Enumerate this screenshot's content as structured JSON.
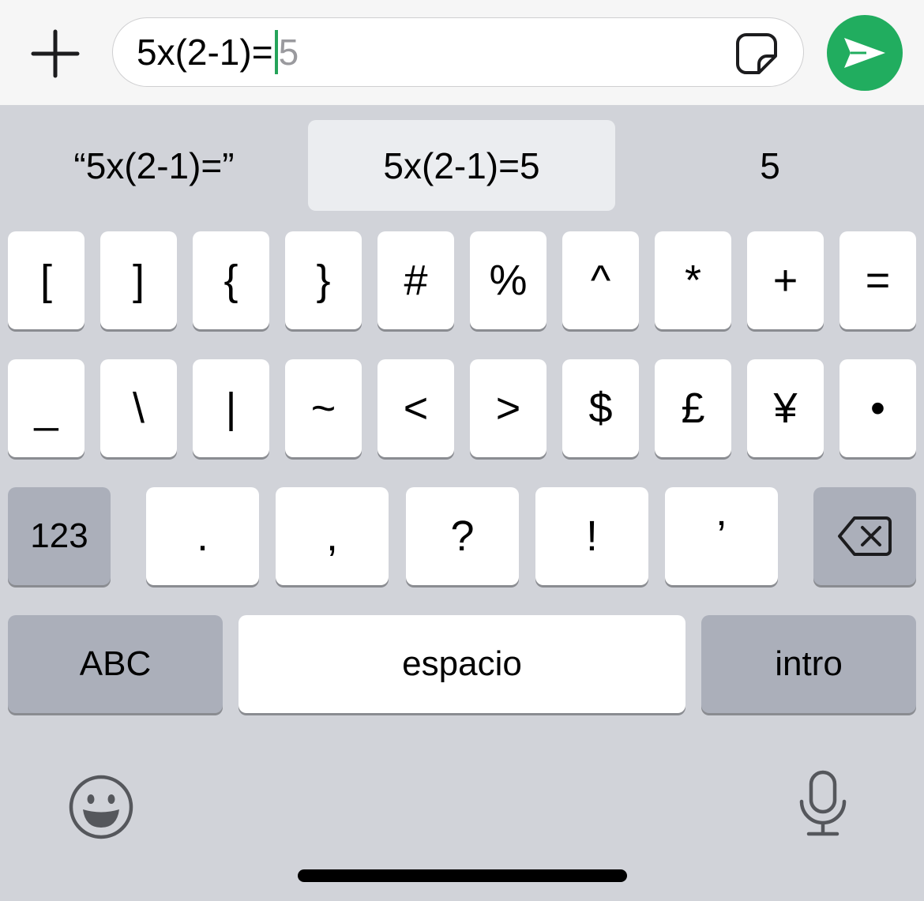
{
  "composer": {
    "typed_text": "5x(2-1)=",
    "inline_suggestion": "5",
    "plus_icon": "plus-icon",
    "sticker_icon": "sticker-icon",
    "send_icon": "send-arrow-icon",
    "send_color": "#21ad5f"
  },
  "suggestions": [
    {
      "label": "“5x(2-1)=”",
      "selected": false
    },
    {
      "label": "5x(2-1)=5",
      "selected": true
    },
    {
      "label": "5",
      "selected": false
    }
  ],
  "keyboard": {
    "row1": [
      "[",
      "]",
      "{",
      "}",
      "#",
      "%",
      "^",
      "*",
      "+",
      "="
    ],
    "row2": [
      "_",
      "\\",
      "|",
      "~",
      "<",
      ">",
      "$",
      "£",
      "¥",
      "•"
    ],
    "row3": {
      "mode_key": "123",
      "keys": [
        ".",
        ",",
        "?",
        "!",
        "’"
      ],
      "delete_icon": "backspace-icon"
    },
    "row4": {
      "abc_key": "ABC",
      "space_key": "espacio",
      "return_key": "intro"
    },
    "bottom": {
      "emoji_icon": "emoji-icon",
      "mic_icon": "microphone-icon"
    }
  }
}
